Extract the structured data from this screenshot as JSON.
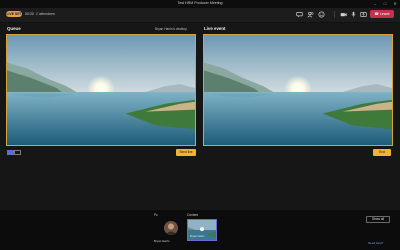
{
  "window": {
    "title": "Test HRM Producer Meeting",
    "controls": {
      "minimize": "–",
      "maximize": "□",
      "close": "✕"
    }
  },
  "toolbar": {
    "status_tag": "LIVE SET",
    "timer": "00:20",
    "participants": "2 attendees",
    "icons": [
      "chat-icon",
      "people-icon",
      "reactions-icon",
      "more-icon",
      "camera-icon",
      "mic-icon",
      "share-icon"
    ],
    "leave_label": "Leave"
  },
  "queue": {
    "title": "Queue",
    "subtitle": "Bryan Harris's desktop",
    "send_button": "Send live"
  },
  "live": {
    "title": "Live event",
    "end_button": "End"
  },
  "bottom": {
    "pc_label": "Pc",
    "content_label": "Content",
    "person_name": "Bryan Harris",
    "thumb_label": "Bryan Harris",
    "show_all": "Show all",
    "need_help": "Need help?"
  },
  "colors": {
    "accent_gold": "#f2b233",
    "frame_border": "#d4a43a",
    "leave_red": "#c4314b",
    "link_blue": "#7a9cff"
  }
}
